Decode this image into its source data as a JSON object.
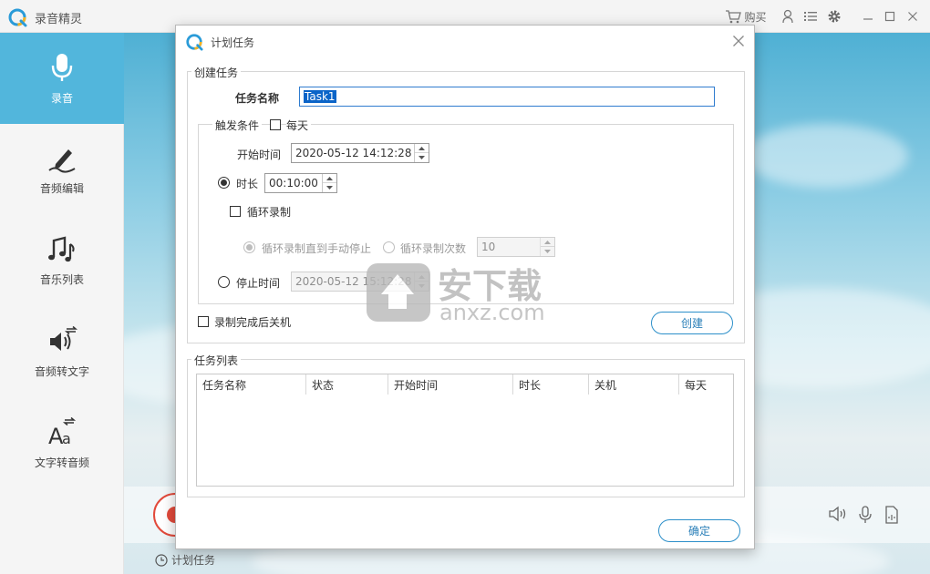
{
  "app": {
    "title": "录音精灵",
    "buy_label": "购买",
    "brand_color": "#52b6dc"
  },
  "sidebar": {
    "items": [
      {
        "label": "录音",
        "icon": "microphone-icon",
        "active": true
      },
      {
        "label": "音频编辑",
        "icon": "pen-edit-icon"
      },
      {
        "label": "音乐列表",
        "icon": "music-notes-icon"
      },
      {
        "label": "音频转文字",
        "icon": "speaker-convert-icon"
      },
      {
        "label": "文字转音频",
        "icon": "text-convert-icon"
      }
    ]
  },
  "footer": {
    "schedule_label": "计划任务"
  },
  "dialog": {
    "title": "计划任务",
    "create_group": {
      "legend": "创建任务",
      "task_name_label": "任务名称",
      "task_name_value": "Task1",
      "trigger_legend": "触发条件",
      "daily_label": "每天",
      "daily_checked": false,
      "start_time_label": "开始时间",
      "start_time_value": "2020-05-12 14:12:28",
      "duration_label": "时长",
      "duration_value": "00:10:00",
      "duration_selected": true,
      "loop_label": "循环录制",
      "loop_checked": false,
      "loop_until_stop_label": "循环录制直到手动停止",
      "loop_count_label": "循环录制次数",
      "loop_count_value": "10",
      "stop_time_label": "停止时间",
      "stop_time_value": "2020-05-12 15:12:28",
      "stop_time_selected": false,
      "shutdown_label": "录制完成后关机",
      "shutdown_checked": false,
      "create_button": "创建"
    },
    "task_list": {
      "legend": "任务列表",
      "columns": [
        "任务名称",
        "状态",
        "开始时间",
        "时长",
        "关机",
        "每天"
      ],
      "rows": []
    },
    "ok_button": "确定"
  },
  "watermark": {
    "text_main": "安下载",
    "text_sub": "anxz.com"
  }
}
